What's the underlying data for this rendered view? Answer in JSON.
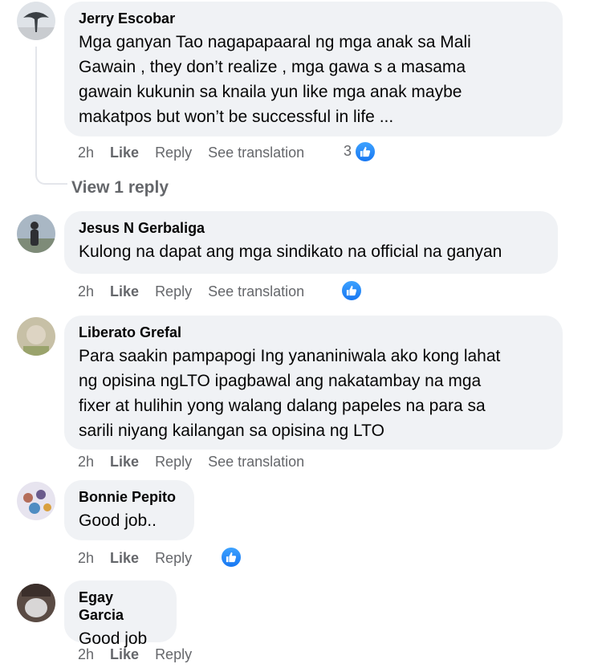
{
  "comments": [
    {
      "author": "Jerry Escobar",
      "text": "Mga ganyan Tao nagapapaaral ng mga anak sa Mali\nGawain , they don’t realize , mga gawa s a masama\ngawain kukunin sa knaila yun like mga anak maybe\nmakatpos but won’t be successful in life ...",
      "time": "2h",
      "like": "Like",
      "reply": "Reply",
      "translate": "See translation",
      "reaction_count": "3",
      "reaction_icon": "thumbs-up-icon"
    },
    {
      "author": "Jesus N Gerbaliga",
      "text": "Kulong na dapat ang mga sindikato na official na ganyan",
      "time": "2h",
      "like": "Like",
      "reply": "Reply",
      "translate": "See translation",
      "reaction_icon": "thumbs-up-icon"
    },
    {
      "author": "Liberato Grefal",
      "text": "Para saakin pampapogi Ing yananiniwala ako kong lahat\nng opisina ngLTO ipagbawal ang nakatambay na mga\nfixer at hulihin yong walang dalang papeles na para sa\nsarili niyang kailangan sa opisina ng LTO",
      "time": "2h",
      "like": "Like",
      "reply": "Reply",
      "translate": "See translation"
    },
    {
      "author": "Bonnie Pepito",
      "text": "Good job..",
      "time": "2h",
      "like": "Like",
      "reply": "Reply",
      "reaction_icon": "thumbs-up-icon"
    },
    {
      "author": "Egay Garcia",
      "text": "Good job",
      "time": "2h",
      "like": "Like",
      "reply": "Reply"
    }
  ],
  "view_replies": "View 1 reply",
  "colors": {
    "bubble": "#f0f2f5",
    "muted": "#65676b",
    "like_blue": "#1877f2"
  }
}
